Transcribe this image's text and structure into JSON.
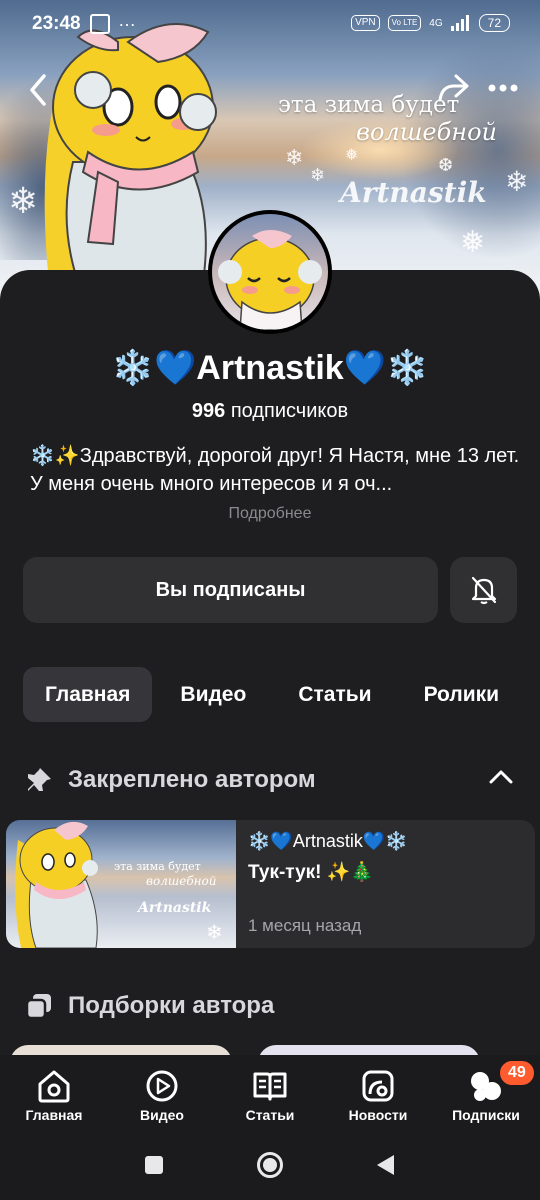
{
  "status_bar": {
    "time": "23:48",
    "vpn": "VPN",
    "volte": "Vo LTE",
    "network": "4G",
    "battery": "72"
  },
  "banner": {
    "line1": "эта зима будет",
    "line2": "волшебной",
    "signature": "Artnastik"
  },
  "profile": {
    "name": "❄️💙Artnastik💙❄️",
    "subscribers_count": "996",
    "subscribers_label": "подписчиков",
    "description": "❄️✨Здравствуй, дорогой друг! Я Настя, мне 13 лет. У меня очень много интересов и я оч...",
    "more": "Подробнее"
  },
  "actions": {
    "subscribed_label": "Вы подписаны"
  },
  "tabs": [
    {
      "label": "Главная",
      "active": true
    },
    {
      "label": "Видео",
      "active": false
    },
    {
      "label": "Статьи",
      "active": false
    },
    {
      "label": "Ролики",
      "active": false
    }
  ],
  "pinned": {
    "title": "Закреплено автором",
    "card": {
      "channel": "❄️💙Artnastik💙❄️",
      "title": "Тук-тук! ✨🎄",
      "time": "1 месяц назад",
      "thumb_line1": "эта зима будет",
      "thumb_line2": "волшебной",
      "thumb_signature": "Artnastik"
    }
  },
  "collections": {
    "title": "Подборки автора"
  },
  "bottom_nav": [
    {
      "label": "Главная",
      "icon": "home-icon"
    },
    {
      "label": "Видео",
      "icon": "video-icon"
    },
    {
      "label": "Статьи",
      "icon": "articles-icon"
    },
    {
      "label": "Новости",
      "icon": "news-icon"
    },
    {
      "label": "Подписки",
      "icon": "subscriptions-icon",
      "badge": "49"
    }
  ],
  "colors": {
    "background": "#1e1e20",
    "button": "#303033",
    "badge": "#ff5b2e"
  }
}
